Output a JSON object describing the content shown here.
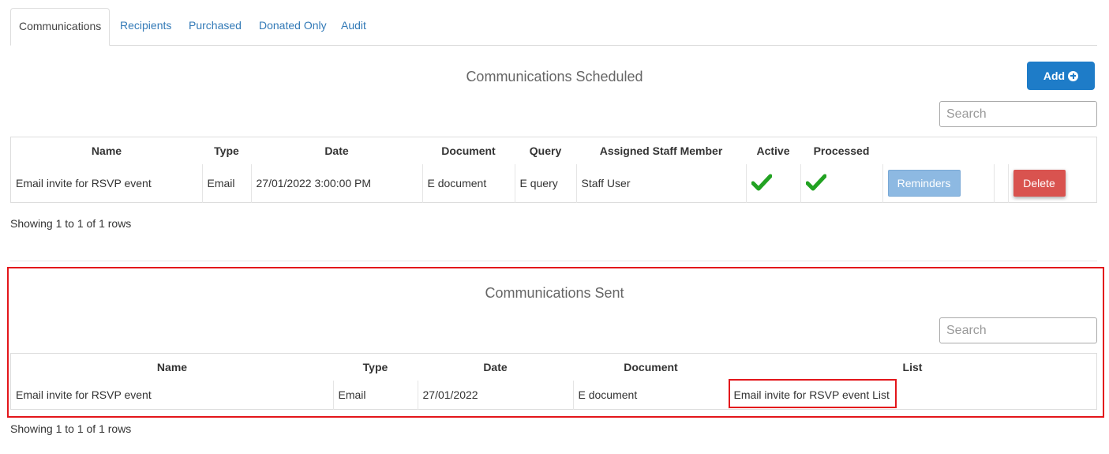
{
  "tabs": [
    {
      "label": "Communications",
      "active": true
    },
    {
      "label": "Recipients"
    },
    {
      "label": "Purchased"
    },
    {
      "label": "Donated Only"
    },
    {
      "label": "Audit"
    }
  ],
  "scheduled": {
    "title": "Communications Scheduled",
    "add_label": "Add",
    "search_placeholder": "Search",
    "columns": [
      "Name",
      "Type",
      "Date",
      "Document",
      "Query",
      "Assigned Staff Member",
      "Active",
      "Processed"
    ],
    "rows": [
      {
        "name": "Email invite for RSVP event",
        "type": "Email",
        "date": "27/01/2022 3:00:00 PM",
        "document": "E document",
        "query": "E query",
        "staff": "Staff User",
        "active": true,
        "processed": true,
        "reminders_label": "Reminders",
        "delete_label": "Delete"
      }
    ],
    "pagination": "Showing 1 to 1 of 1 rows"
  },
  "sent": {
    "title": "Communications Sent",
    "search_placeholder": "Search",
    "columns": [
      "Name",
      "Type",
      "Date",
      "Document",
      "List"
    ],
    "rows": [
      {
        "name": "Email invite for RSVP event",
        "type": "Email",
        "date": "27/01/2022",
        "document": "E document",
        "list": "Email invite for RSVP event List"
      }
    ],
    "pagination": "Showing 1 to 1 of 1 rows"
  },
  "colors": {
    "primary": "#1e7cc8",
    "danger": "#d9534f",
    "check": "#22a222",
    "highlight": "#e3161b"
  },
  "icons": {
    "add": "plus-circle-icon",
    "active": "check-icon",
    "processed": "check-icon"
  }
}
